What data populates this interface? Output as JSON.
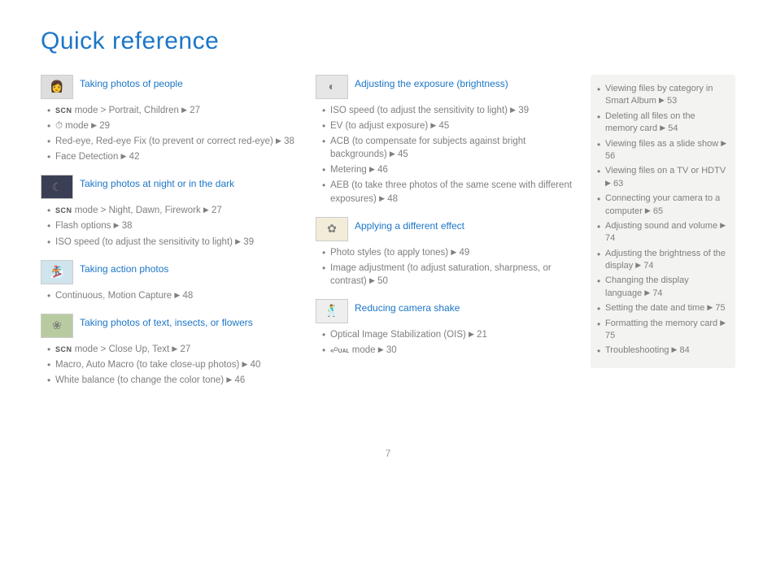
{
  "title": "Quick reference",
  "pagenum": "7",
  "arrow": "▶",
  "col1": [
    {
      "title": "Taking photos of people",
      "icon": "👩",
      "bg": "#ddd",
      "items": [
        {
          "pre": "SCN",
          "t": " mode > Portrait, Children ",
          "p": "27"
        },
        {
          "pre": "⏱",
          "t": " mode ",
          "p": "29"
        },
        {
          "t": "Red-eye, Red-eye Fix (to prevent or correct red-eye) ",
          "p": "38"
        },
        {
          "t": "Face Detection ",
          "p": "42"
        }
      ]
    },
    {
      "title": "Taking photos at night or in the dark",
      "icon": "☾",
      "bg": "#3a3f55",
      "items": [
        {
          "pre": "SCN",
          "t": " mode > Night, Dawn, Firework ",
          "p": "27"
        },
        {
          "t": "Flash options ",
          "p": "38"
        },
        {
          "t": "ISO speed (to adjust the sensitivity to light) ",
          "p": "39"
        }
      ]
    },
    {
      "title": "Taking action photos",
      "icon": "🏂",
      "bg": "#cfe4ed",
      "items": [
        {
          "t": "Continuous, Motion Capture ",
          "p": "48"
        }
      ]
    },
    {
      "title": "Taking photos of text, insects, or flowers",
      "icon": "❀",
      "bg": "#b8cba0",
      "items": [
        {
          "pre": "SCN",
          "t": " mode > Close Up, Text ",
          "p": "27"
        },
        {
          "t": "Macro, Auto Macro (to take close-up photos) ",
          "p": "40"
        },
        {
          "t": "White balance (to change the color tone) ",
          "p": "46"
        }
      ]
    }
  ],
  "col2": [
    {
      "title": "Adjusting the exposure (brightness)",
      "icon": "◐",
      "bg": "#e6e6e6",
      "items": [
        {
          "t": "ISO speed (to adjust the sensitivity to light) ",
          "p": "39"
        },
        {
          "t": "EV (to adjust exposure) ",
          "p": "45"
        },
        {
          "t": "ACB (to compensate for subjects against bright backgrounds) ",
          "p": "45"
        },
        {
          "t": "Metering ",
          "p": "46"
        },
        {
          "t": "AEB (to take three photos of the same scene with different exposures) ",
          "p": "48"
        }
      ]
    },
    {
      "title": "Applying a different effect",
      "icon": "✿",
      "bg": "#f2ecd9",
      "items": [
        {
          "t": "Photo styles (to apply tones) ",
          "p": "49"
        },
        {
          "t": "Image adjustment (to adjust saturation, sharpness, or contrast) ",
          "p": "50"
        }
      ]
    },
    {
      "title": "Reducing camera shake",
      "icon": "🕺",
      "bg": "#eee",
      "items": [
        {
          "t": "Optical Image Stabilization (OIS) ",
          "p": "21"
        },
        {
          "pre": "DUAL",
          "t": " mode ",
          "p": "30"
        }
      ]
    }
  ],
  "side": [
    {
      "t": "Viewing files by category in Smart Album ",
      "p": "53"
    },
    {
      "t": "Deleting all files on the memory card ",
      "p": "54"
    },
    {
      "t": "Viewing files as a slide show ",
      "p": "56"
    },
    {
      "t": "Viewing files on a TV or HDTV ",
      "p": "63"
    },
    {
      "t": "Connecting your camera to a computer ",
      "p": "65"
    },
    {
      "t": "Adjusting sound and volume ",
      "p": "74"
    },
    {
      "t": "Adjusting the brightness of the display ",
      "p": "74"
    },
    {
      "t": "Changing the display language ",
      "p": "74"
    },
    {
      "t": "Setting the date and time ",
      "p": "75"
    },
    {
      "t": "Formatting the memory card ",
      "p": "75"
    },
    {
      "t": "Troubleshooting ",
      "p": "84"
    }
  ]
}
